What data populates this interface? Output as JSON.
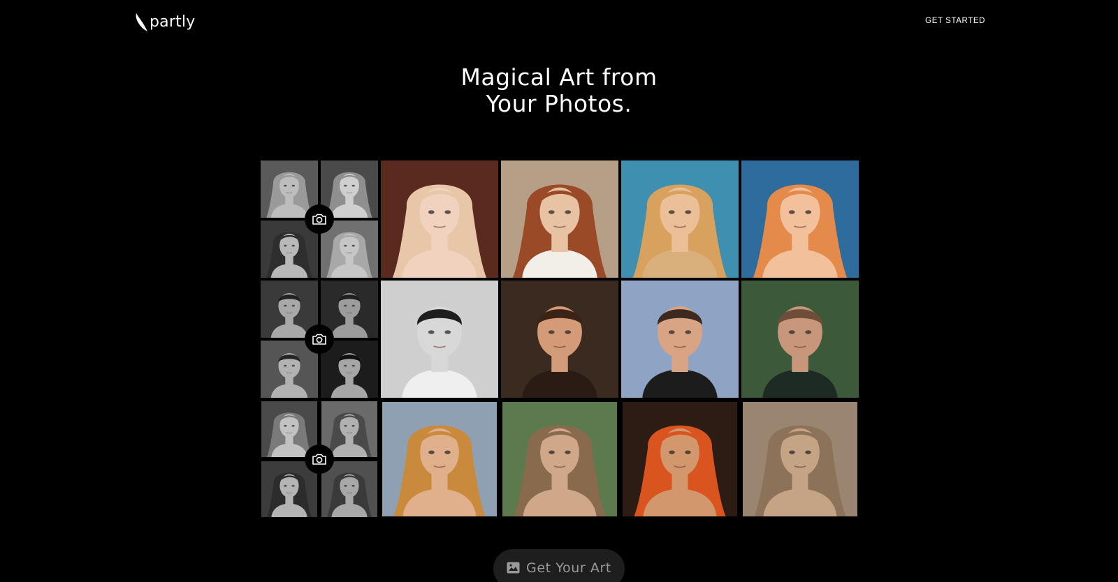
{
  "brand": {
    "name": "partly"
  },
  "header": {
    "cta_label": "GET STARTED"
  },
  "hero": {
    "title_line1": "Magical Art from",
    "title_line2": "Your Photos."
  },
  "colors": {
    "background": "#000000",
    "text": "#ffffff",
    "cta_bg": "#1e1e1e",
    "cta_text": "#9a9a9a"
  },
  "gallery": {
    "rows": [
      {
        "subject": "woman-blonde",
        "upload_icon": "camera-icon",
        "source_photos": [
          {
            "bg": "#5a5a5a",
            "hair": "#9a9a9a",
            "skin": "#bdbdbd"
          },
          {
            "bg": "#4a4a4a",
            "hair": "#8f8f8f",
            "skin": "#cfcfcf"
          },
          {
            "bg": "#3a3a3a",
            "hair": "#2e2e2e",
            "skin": "#b8b8b8"
          },
          {
            "bg": "#707070",
            "hair": "#a8a8a8",
            "skin": "#c6c6c6"
          }
        ],
        "artworks": [
          {
            "bg": "#5a2a1e",
            "hair": "#e8c6a8",
            "skin": "#f0d2be",
            "clothes": "#f0d2be"
          },
          {
            "bg": "#b59f86",
            "hair": "#9a4a26",
            "skin": "#e7c3a3",
            "clothes": "#f2efe8"
          },
          {
            "bg": "#3f8fb0",
            "hair": "#d9a15e",
            "skin": "#ebbf98",
            "clothes": "#d9b07b"
          },
          {
            "bg": "#2e6c9e",
            "hair": "#e48a4a",
            "skin": "#f2c09a",
            "clothes": "#f2c09a"
          }
        ]
      },
      {
        "subject": "man-short-hair",
        "upload_icon": "camera-icon",
        "source_photos": [
          {
            "bg": "#3a3a3a",
            "hair": "#222222",
            "skin": "#a8a8a8"
          },
          {
            "bg": "#2a2a2a",
            "hair": "#1f1f1f",
            "skin": "#9c9c9c"
          },
          {
            "bg": "#555555",
            "hair": "#262626",
            "skin": "#b2b2b2"
          },
          {
            "bg": "#1c1c1c",
            "hair": "#111111",
            "skin": "#a6a6a6"
          }
        ],
        "artworks": [
          {
            "bg": "#cfcfcf",
            "hair": "#1e1e1e",
            "skin": "#d8d8d8",
            "clothes": "#efefef"
          },
          {
            "bg": "#3a2a20",
            "hair": "#3b2416",
            "skin": "#d39b77",
            "clothes": "#2a1c14"
          },
          {
            "bg": "#8fa3c4",
            "hair": "#3c2a20",
            "skin": "#d8a484",
            "clothes": "#1c1c1c"
          },
          {
            "bg": "#3c5a3a",
            "hair": "#6e4e38",
            "skin": "#c8967a",
            "clothes": "#1e2a24"
          }
        ]
      },
      {
        "subject": "woman-wavy-hair",
        "upload_icon": "camera-icon",
        "source_photos": [
          {
            "bg": "#4a4a4a",
            "hair": "#7a7a7a",
            "skin": "#c2c2c2"
          },
          {
            "bg": "#6a6a6a",
            "hair": "#4a4a4a",
            "skin": "#b0b0b0"
          },
          {
            "bg": "#3c3c3c",
            "hair": "#2c2c2c",
            "skin": "#b4b4b4"
          },
          {
            "bg": "#505050",
            "hair": "#3a3a3a",
            "skin": "#a8a8a8"
          }
        ],
        "artworks": [
          {
            "bg": "#8ea0b2",
            "hair": "#c98a3c",
            "skin": "#e0b08c",
            "clothes": "#e0b08c"
          },
          {
            "bg": "#5c7a4e",
            "hair": "#8a6a4c",
            "skin": "#cfa88a",
            "clothes": "#cfa88a"
          },
          {
            "bg": "#2c1c14",
            "hair": "#d9541e",
            "skin": "#d3976e",
            "clothes": "#d3976e"
          },
          {
            "bg": "#9a8670",
            "hair": "#8c7258",
            "skin": "#c4a484",
            "clothes": "#c4a484"
          }
        ]
      }
    ]
  },
  "cta": {
    "label": "Get Your Art",
    "icon": "image-icon"
  }
}
